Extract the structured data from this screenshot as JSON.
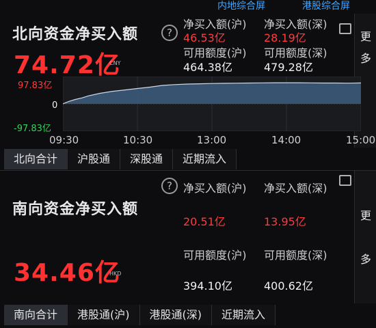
{
  "top_links": [
    "内地综合屏",
    "港股综合屏"
  ],
  "north": {
    "title": "北向资金净买入额",
    "help": "?",
    "value": "74.72亿",
    "unit": "CNY",
    "net_buy_sh_label": "净买入额(沪)",
    "net_buy_sz_label": "净买入额(深)",
    "net_buy_sh": "46.53亿",
    "net_buy_sz": "28.19亿",
    "quota_sh_label": "可用额度(沪)",
    "quota_sz_label": "可用额度(深)",
    "quota_sh": "464.38亿",
    "quota_sz": "479.28亿",
    "more": [
      "更",
      "多"
    ],
    "tabs": [
      "北向合计",
      "沪股通",
      "深股通",
      "近期流入"
    ]
  },
  "chart_data": {
    "type": "area",
    "ytick_labels": [
      "97.83亿",
      "0",
      "-97.83亿"
    ],
    "ylim": [
      -97.83,
      97.83
    ],
    "x_ticks": [
      "09:30",
      "10:30",
      "13:00",
      "14:00",
      "15:00"
    ],
    "x": [
      0,
      2,
      5,
      10,
      15,
      20,
      25,
      30,
      40,
      50,
      60,
      70,
      80,
      90,
      100,
      110,
      120,
      130,
      140,
      150,
      160,
      170,
      180,
      190,
      200,
      210,
      220,
      230,
      240
    ],
    "values": [
      0,
      4,
      9,
      16,
      21,
      28,
      33,
      38,
      45,
      50,
      55,
      60,
      66,
      69,
      71,
      72,
      73,
      73.5,
      74,
      74.5,
      75,
      75.5,
      75.5,
      75.5,
      75,
      74.5,
      74.5,
      74,
      74.72
    ],
    "fill_color": "#3b5a78",
    "line_color": "#cfd9e6"
  },
  "south": {
    "title": "南向资金净买入额",
    "help": "?",
    "value": "34.46亿",
    "unit": "HKD",
    "net_buy_sh_label": "净买入额(沪)",
    "net_buy_sz_label": "净买入额(深)",
    "net_buy_sh": "20.51亿",
    "net_buy_sz": "13.95亿",
    "quota_sh_label": "可用额度(沪)",
    "quota_sz_label": "可用额度(深)",
    "quota_sh": "394.10亿",
    "quota_sz": "400.62亿",
    "more": [
      "更",
      "多"
    ],
    "tabs": [
      "南向合计",
      "港股通(沪)",
      "港股通(深)",
      "近期流入"
    ]
  }
}
